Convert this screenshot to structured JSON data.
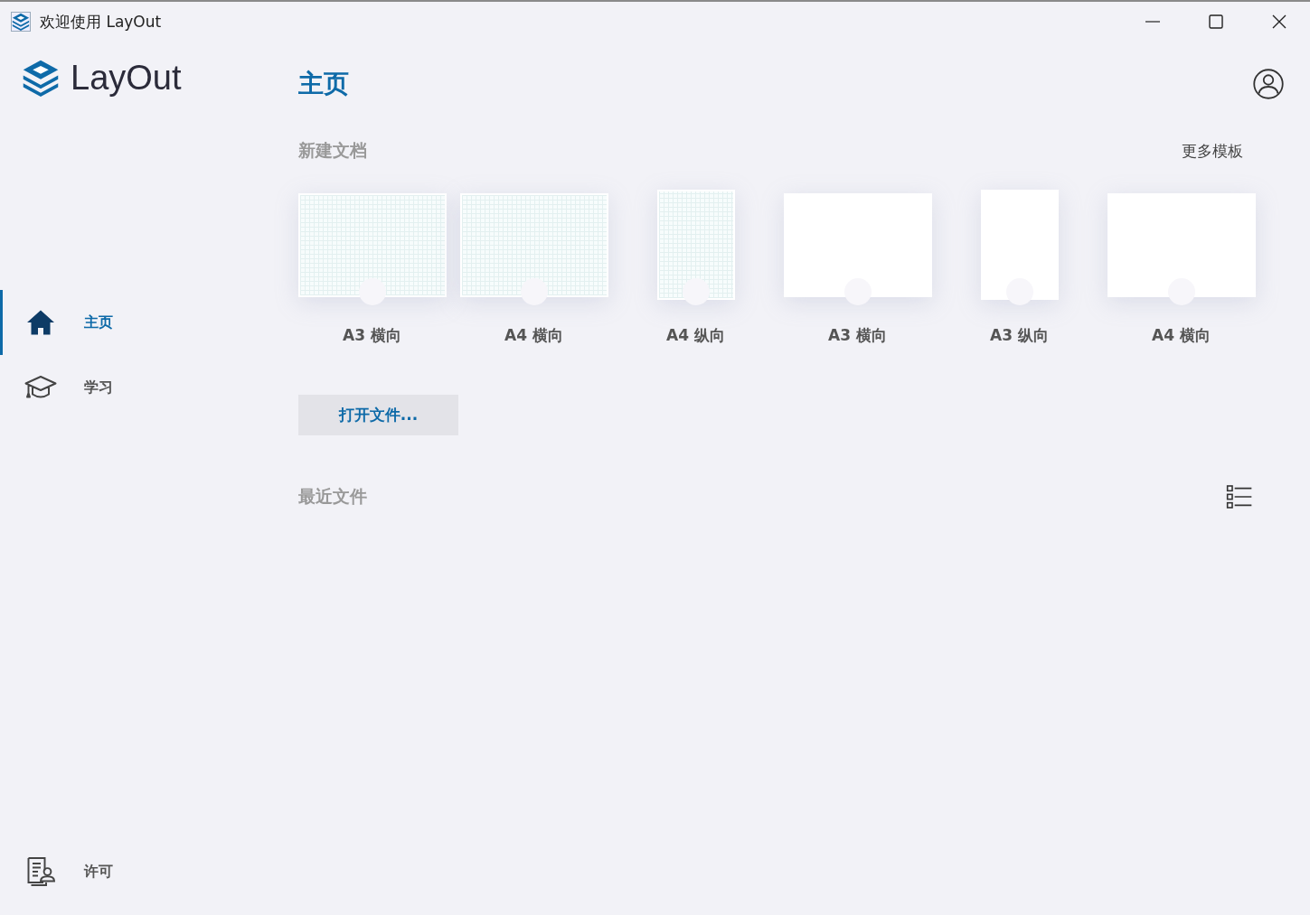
{
  "window": {
    "title": "欢迎使用 LayOut"
  },
  "logo": {
    "text": "LayOut"
  },
  "sidebar": {
    "items": [
      {
        "label": "主页",
        "selected": true
      },
      {
        "label": "学习",
        "selected": false
      }
    ],
    "footer_item": {
      "label": "许可",
      "selected": false
    }
  },
  "page_title": "主页",
  "new_document": {
    "heading": "新建文档",
    "more_link": "更多模板",
    "templates": [
      {
        "label": "A3 横向",
        "kind": "grid",
        "portrait": false
      },
      {
        "label": "A4 横向",
        "kind": "grid",
        "portrait": false
      },
      {
        "label": "A4 纵向",
        "kind": "grid",
        "portrait": true
      },
      {
        "label": "A3 横向",
        "kind": "blank",
        "portrait": false
      },
      {
        "label": "A3 纵向",
        "kind": "blank",
        "portrait": true
      },
      {
        "label": "A4 横向",
        "kind": "blank",
        "portrait": false
      }
    ]
  },
  "open_button": "打开文件...",
  "recent_files": {
    "heading": "最近文件"
  }
}
